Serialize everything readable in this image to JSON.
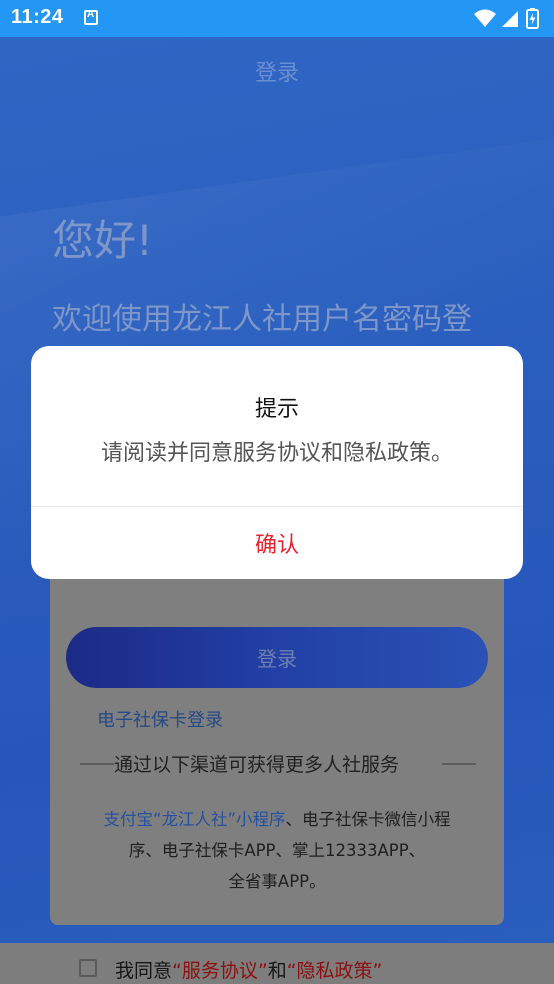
{
  "status_bar": {
    "time": "11:24",
    "icons": [
      "app-notification-icon",
      "wifi-icon",
      "cell-signal-icon",
      "battery-charging-icon"
    ]
  },
  "header": {
    "title": "登录"
  },
  "greeting": {
    "hello": "您好!",
    "welcome": "欢迎使用龙江人社用户名密码登"
  },
  "login": {
    "button_label": "登录",
    "ecard_link": "电子社保卡登录"
  },
  "channels": {
    "title": "通过以下渠道可获得更多人社服务",
    "link": "支付宝“龙江人社”小程序",
    "text_line1": "、电子社保卡微信小程",
    "text_line2": "序、电子社保卡APP、掌上12333APP、",
    "text_line3": "全省事APP。"
  },
  "agreement": {
    "prefix": "我同意",
    "service": "“服务协议”",
    "and": "和",
    "privacy": "“隐私政策”"
  },
  "dialog": {
    "title": "提示",
    "message": "请阅读并同意服务协议和隐私政策。",
    "confirm_label": "确认"
  },
  "colors": {
    "status_bar": "#2397f3",
    "page_overlay": "#2b5fbf",
    "confirm_red": "#e8232e",
    "dialog_bg": "#ffffff"
  }
}
